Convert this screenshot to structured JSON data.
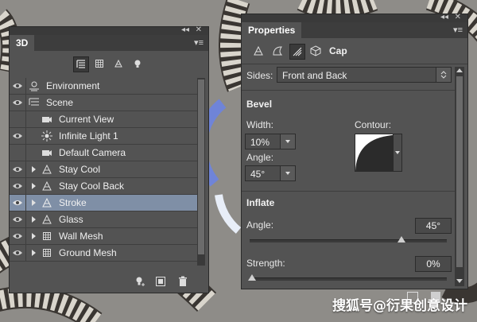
{
  "panel3d": {
    "tab_label": "3D",
    "collapse_glyph": "◂◂",
    "close_glyph": "✕",
    "menu_glyph": "▾≡",
    "filter_icons": [
      "whole-scene-icon",
      "meshes-icon",
      "materials-icon",
      "lights-icon"
    ],
    "items": [
      {
        "label": "Environment",
        "icon": "environment-icon",
        "eye": true
      },
      {
        "label": "Scene",
        "icon": "scene-icon",
        "eye": true
      },
      {
        "label": "Current View",
        "icon": "camera-icon",
        "eye": false
      },
      {
        "label": "Infinite Light 1",
        "icon": "light-icon",
        "eye": true
      },
      {
        "label": "Default Camera",
        "icon": "camera-icon",
        "eye": false
      },
      {
        "label": "Stay  Cool",
        "icon": "mesh-icon",
        "eye": true,
        "expand": true
      },
      {
        "label": "Stay  Cool Back",
        "icon": "mesh-icon",
        "eye": true,
        "expand": true
      },
      {
        "label": "Stroke",
        "icon": "mesh-icon",
        "eye": true,
        "expand": true,
        "selected": true
      },
      {
        "label": "Glass",
        "icon": "mesh-icon",
        "eye": true,
        "expand": true
      },
      {
        "label": "Wall Mesh",
        "icon": "wall-mesh-icon",
        "eye": true,
        "expand": true
      },
      {
        "label": "Ground Mesh",
        "icon": "wall-mesh-icon",
        "eye": true,
        "expand": true
      }
    ],
    "bottom_icons": [
      "add-light-icon",
      "render-icon",
      "delete-icon"
    ]
  },
  "properties": {
    "tab_label": "Properties",
    "collapse_glyph": "◂◂",
    "close_glyph": "✕",
    "menu_glyph": "▾≡",
    "toolbar_icons": [
      "mesh-tool-icon",
      "deform-tool-icon",
      "cap-tool-icon",
      "coordinates-tool-icon"
    ],
    "section_title": "Cap",
    "sides_label": "Sides:",
    "sides_value": "Front and Back",
    "bevel": {
      "title": "Bevel",
      "width_label": "Width:",
      "width_value": "10%",
      "contour_label": "Contour:",
      "angle_label": "Angle:",
      "angle_value": "45°"
    },
    "inflate": {
      "title": "Inflate",
      "angle_label": "Angle:",
      "angle_value": "45°",
      "angle_slider_fraction": 0.77,
      "strength_label": "Strength:",
      "strength_value": "0%",
      "strength_slider_fraction": 0.0
    }
  },
  "watermark": "搜狐号@衍果创意设计",
  "colors": {
    "panel_bg": "#535353",
    "selected_row": "#7f8fa6",
    "ring_blue": "#6f84d8"
  }
}
